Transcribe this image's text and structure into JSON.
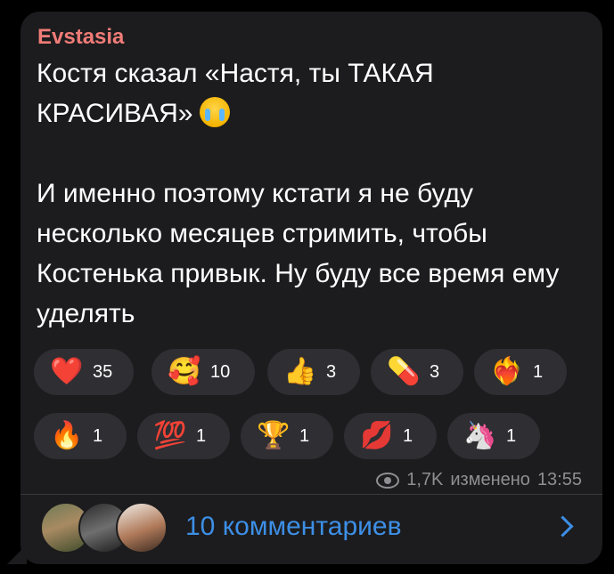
{
  "message": {
    "author": "Evstasia",
    "line1": "Костя сказал «Настя, ты ТАКАЯ КРАСИВАЯ»",
    "body": "И именно поэтому кстати я не буду несколько месяцев стримить, чтобы Костенька привык. Ну буду все время ему уделять"
  },
  "reactions": [
    {
      "emoji": "❤️",
      "count": "35",
      "icon": "red-heart-icon"
    },
    {
      "emoji": "🥰",
      "count": "10",
      "icon": "smiling-face-with-hearts-icon"
    },
    {
      "emoji": "👍",
      "count": "3",
      "icon": "thumbs-up-icon"
    },
    {
      "emoji": "💊",
      "count": "3",
      "icon": "pill-icon"
    },
    {
      "emoji": "❤️‍🔥",
      "count": "1",
      "icon": "heart-on-fire-icon"
    },
    {
      "emoji": "🔥",
      "count": "1",
      "icon": "fire-icon"
    },
    {
      "emoji": "💯",
      "count": "1",
      "icon": "hundred-points-icon"
    },
    {
      "emoji": "🏆",
      "count": "1",
      "icon": "trophy-icon"
    },
    {
      "emoji": "💋",
      "count": "1",
      "icon": "kiss-mark-icon"
    },
    {
      "emoji": "🦄",
      "count": "1",
      "icon": "unicorn-icon"
    }
  ],
  "meta": {
    "views": "1,7K",
    "edited_label": "изменено",
    "time": "13:55"
  },
  "footer": {
    "comments_label": "10 комментариев"
  },
  "colors": {
    "author": "#f07c78",
    "link": "#3d8fe6",
    "bubble": "#1c1c1e",
    "pill": "#2e2e33"
  }
}
